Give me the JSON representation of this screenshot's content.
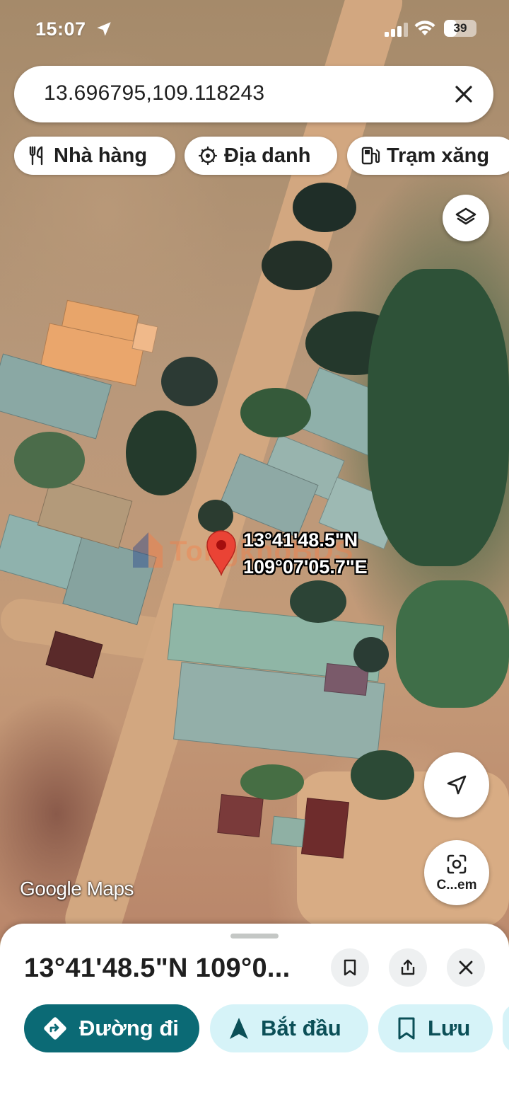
{
  "status_bar": {
    "time": "15:07",
    "battery_level": "39"
  },
  "search": {
    "query": "13.696795,109.118243",
    "clear_icon": "close-icon"
  },
  "chips": [
    {
      "label": "Nhà hàng",
      "icon": "restaurant-icon"
    },
    {
      "label": "Địa danh",
      "icon": "landmark-icon"
    },
    {
      "label": "Trạm xăng",
      "icon": "gas-station-icon"
    }
  ],
  "map": {
    "pin_label_lat": "13°41'48.5\"N",
    "pin_label_lng": "109°07'05.7\"E",
    "watermark": "TongkhoBDS",
    "attribution": "Google Maps",
    "camera_label": "C...em"
  },
  "sheet": {
    "title": "13°41'48.5\"N 109°0...",
    "actions": {
      "directions": "Đường đi",
      "start": "Bắt đầu",
      "save": "Lưu"
    }
  },
  "colors": {
    "primary": "#0b6a75",
    "secondary_bg": "#d6f3f8",
    "pin_red": "#ea4335"
  }
}
